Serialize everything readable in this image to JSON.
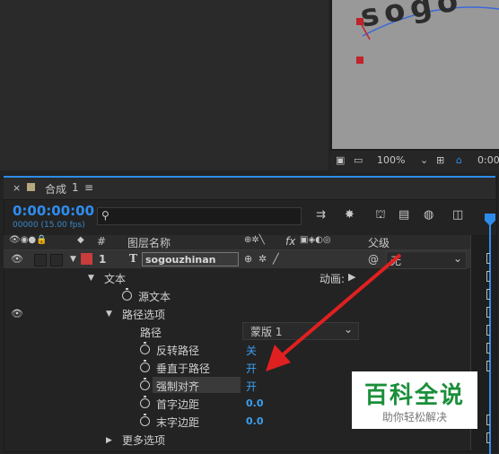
{
  "comp_viewer": {
    "zoom": "100%",
    "time_readout": "0:00",
    "preview_text": "sogo"
  },
  "timeline": {
    "tab_close": "×",
    "tab_title": "合成",
    "tab_number": "1",
    "tab_menu": "≡",
    "timecode": "0:00:00:00",
    "frame_info": "00000 (15.00 fps)",
    "search_icon": "search-icon"
  },
  "columns": {
    "number": "#",
    "layer_name": "图层名称",
    "parent": "父级",
    "fx": "fx"
  },
  "layer": {
    "index": "1",
    "type_glyph": "T",
    "name": "sogouzhinan",
    "parent_value": "无",
    "label_color": "#c83c3c"
  },
  "properties": {
    "text_group": "文本",
    "animate_label": "动画:",
    "source_text": "源文本",
    "path_options": "路径选项",
    "path": "路径",
    "mask_value": "蒙版 1",
    "reverse_path": "反转路径",
    "reverse_value": "关",
    "perpendicular": "垂直于路径",
    "perpendicular_value": "开",
    "force_align": "强制对齐",
    "force_align_value": "开",
    "first_margin": "首字边距",
    "first_margin_value": "0.0",
    "last_margin": "末字边距",
    "last_margin_value": "0.0",
    "more_options": "更多选项"
  },
  "watermark": {
    "title": "百科全说",
    "subtitle": "助你轻松解决"
  }
}
